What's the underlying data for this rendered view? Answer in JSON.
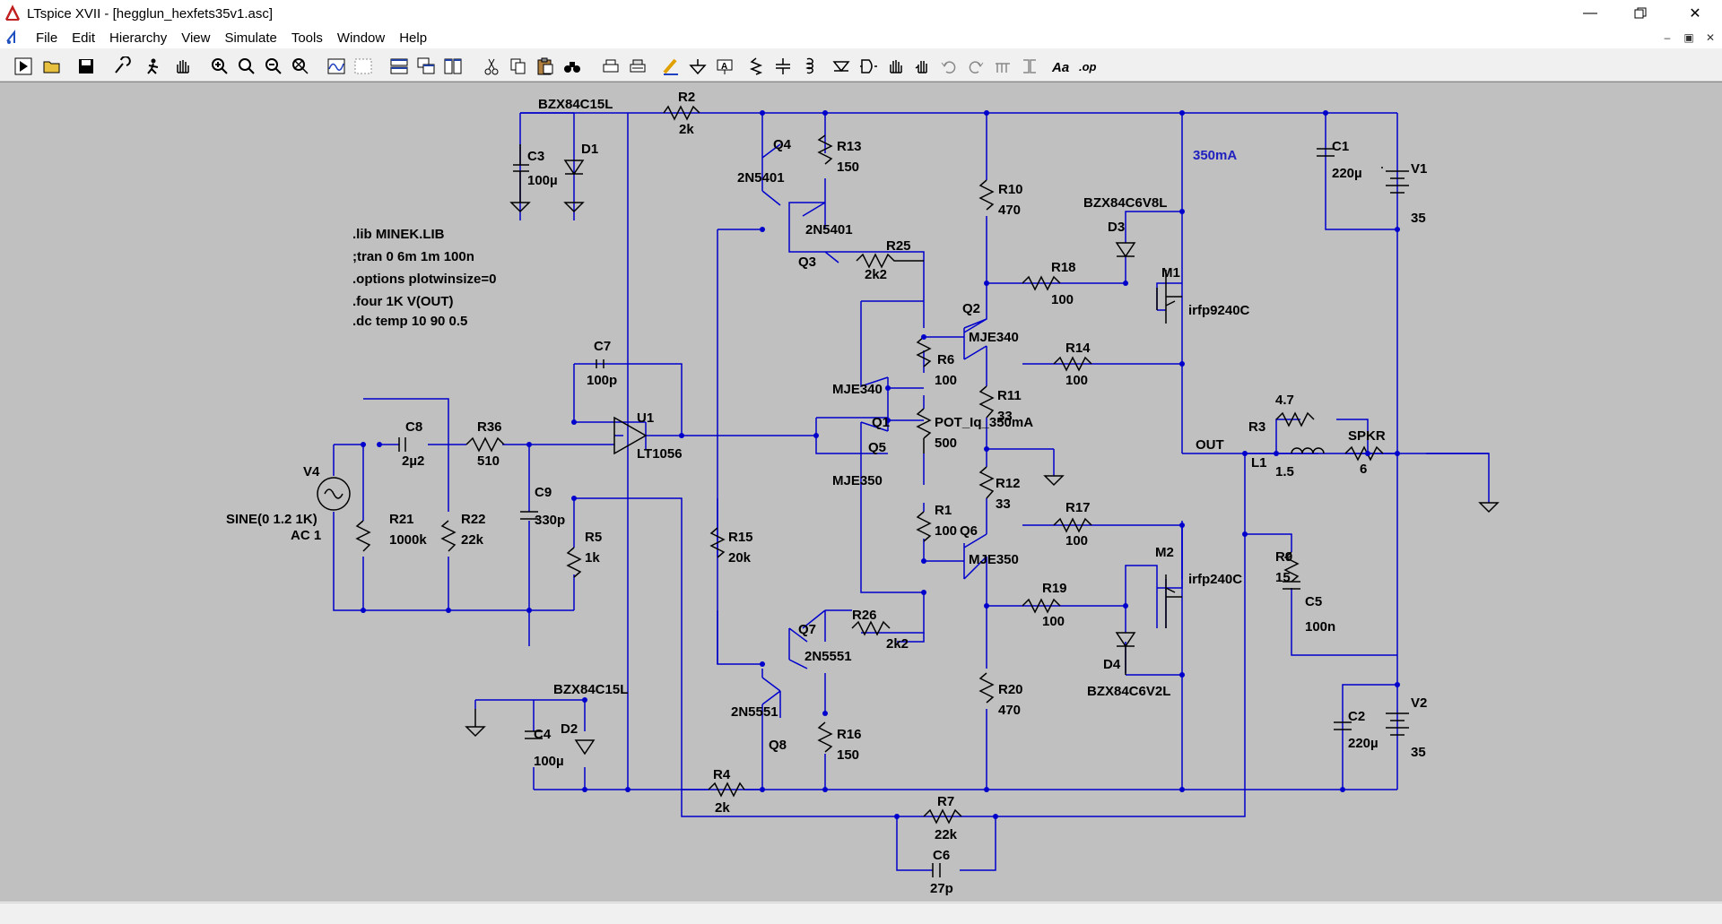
{
  "window": {
    "title": "LTspice XVII - [hegglun_hexfets35v1.asc]"
  },
  "menu": [
    "File",
    "Edit",
    "Hierarchy",
    "View",
    "Simulate",
    "Tools",
    "Window",
    "Help"
  ],
  "toolbar_icons": [
    "run-icon",
    "open-icon",
    "save-icon",
    "control-panel-icon",
    "halt-icon",
    "pan-icon",
    "zoom-in-icon",
    "zoom-area-icon",
    "zoom-out-icon",
    "zoom-fit-icon",
    "waveform-icon",
    "autorange-icon",
    "tile-horizontal-icon",
    "cascade-icon",
    "tile-vertical-icon",
    "cut-icon",
    "copy-icon",
    "paste-icon",
    "find-icon",
    "print-icon",
    "print-preview-icon",
    "draw-wire-icon",
    "ground-icon",
    "label-net-icon",
    "resistor-icon",
    "capacitor-icon",
    "inductor-icon",
    "diode-icon",
    "component-icon",
    "move-icon",
    "drag-icon",
    "undo-icon",
    "redo-icon",
    "rotate-icon",
    "mirror-icon",
    "text-icon",
    "spice-directive-icon"
  ],
  "directives": [
    ".lib MINEK.LIB",
    ";tran 0 6m 1m 100n",
    ".options plotwinsize=0",
    ".four 1K V(OUT)",
    ".dc temp 10 90 0.5"
  ],
  "labels": {
    "bzx_d1": "BZX84C15L",
    "r2": "R2",
    "r2v": "2k",
    "c3": "C3",
    "c3v": "100µ",
    "d1": "D1",
    "q4": "Q4",
    "q4m": "2N5401",
    "r13": "R13",
    "r13v": "150",
    "q3m": "2N5401",
    "q3": "Q3",
    "r25": "R25",
    "r25v": "2k2",
    "r10": "R10",
    "r10v": "470",
    "cur": "350mA",
    "c1": "C1",
    "c1v": "220µ",
    "v1": "V1",
    "v1v": "35",
    "bzx_d3": "BZX84C6V8L",
    "d3": "D3",
    "r18": "R18",
    "r18v": "100",
    "m1": "M1",
    "m1m": "irfp9240C",
    "q2": "Q2",
    "q2m": "MJE340",
    "r6": "R6",
    "r6v": "100",
    "r14": "R14",
    "r14v": "100",
    "c7": "C7",
    "c7v": "100p",
    "u1": "U1",
    "u1m": "LT1056",
    "q1m": "MJE340",
    "q1": "Q1",
    "r11": "R11",
    "r11v": "33",
    "pot": "POT_Iq_350mA",
    "potv": "500",
    "r3v": "4.7",
    "r3": "R3",
    "out": "OUT",
    "spkr": "SPKR",
    "spkrv": "6",
    "l1": "L1",
    "l1v": "1.5",
    "c8": "C8",
    "c8v": "2µ2",
    "r36": "R36",
    "r36v": "510",
    "v4": "V4",
    "q5": "Q5",
    "q5m": "MJE350",
    "r12": "R12",
    "r12v": "33",
    "c9": "C9",
    "c9v": "330p",
    "sine": "SINE(0 1.2 1K)",
    "ac": "AC 1",
    "r21": "R21",
    "r21v": "1000k",
    "r22": "R22",
    "r22v": "22k",
    "r5": "R5",
    "r5v": "1k",
    "r15": "R15",
    "r15v": "20k",
    "r1": "R1",
    "r1v": "100",
    "q6": "Q6",
    "q6m": "MJE350",
    "r17": "R17",
    "r17v": "100",
    "r9": "R9",
    "r9v": "15",
    "c5": "C5",
    "c5v": "100n",
    "m2": "M2",
    "m2m": "irfp240C",
    "r19": "R19",
    "r19v": "100",
    "q7": "Q7",
    "q7m": "2N5551",
    "r26": "R26",
    "r26v": "2k2",
    "d4": "D4",
    "bzx_d4": "BZX84C6V2L",
    "bzx_d2": "BZX84C15L",
    "r20": "R20",
    "r20v": "470",
    "q8m": "2N5551",
    "q8": "Q8",
    "r16": "R16",
    "r16v": "150",
    "c4": "C4",
    "c4v": "100µ",
    "d2": "D2",
    "c2": "C2",
    "c2v": "220µ",
    "v2": "V2",
    "v2v": "35",
    "r4": "R4",
    "r4v": "2k",
    "r7": "R7",
    "r7v": "22k",
    "c6": "C6",
    "c6v": "27p"
  }
}
